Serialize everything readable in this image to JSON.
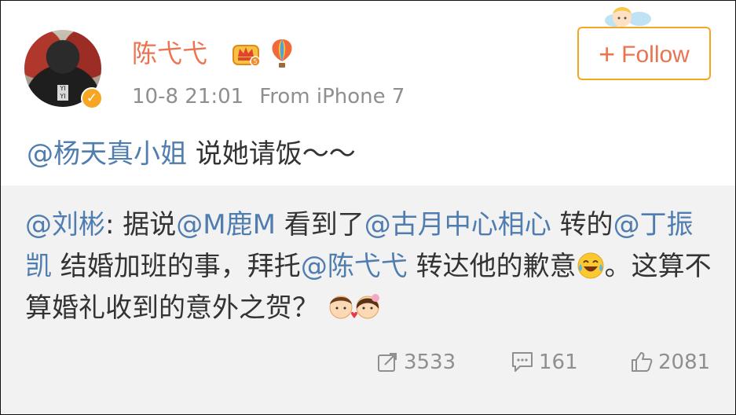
{
  "user": {
    "name": "陈弋弋",
    "timestamp": "10-8 21:01",
    "source": "From iPhone 7"
  },
  "follow_button": {
    "label": "Follow"
  },
  "post": {
    "mention": "@杨天真小姐",
    "text": " 说她请饭～～"
  },
  "retweet": {
    "author": "@刘彬",
    "seg1": ": 据说",
    "m1": "@M鹿M",
    "seg2": " 看到了",
    "m2": "@古月中心相心",
    "seg3": " 转的",
    "m3": "@丁振凯",
    "seg4": " 结婚加班的事，拜托",
    "m4": "@陈弋弋",
    "seg5": " 转达他的歉意",
    "seg6": "。这算不算婚礼收到的意外之贺？"
  },
  "actions": {
    "reposts": "3533",
    "comments": "161",
    "likes": "2081"
  },
  "colors": {
    "accent": "#eb7350",
    "link": "#507daf",
    "meta": "#8f8f8f",
    "retweet_bg": "#f2f2f2",
    "verified": "#f6a623"
  },
  "icons": [
    "verified-icon",
    "crown-icon",
    "balloon-icon",
    "angel-icon",
    "laugh-cry-emoji",
    "couple-emoji",
    "repost-icon",
    "comment-icon",
    "like-icon"
  ]
}
